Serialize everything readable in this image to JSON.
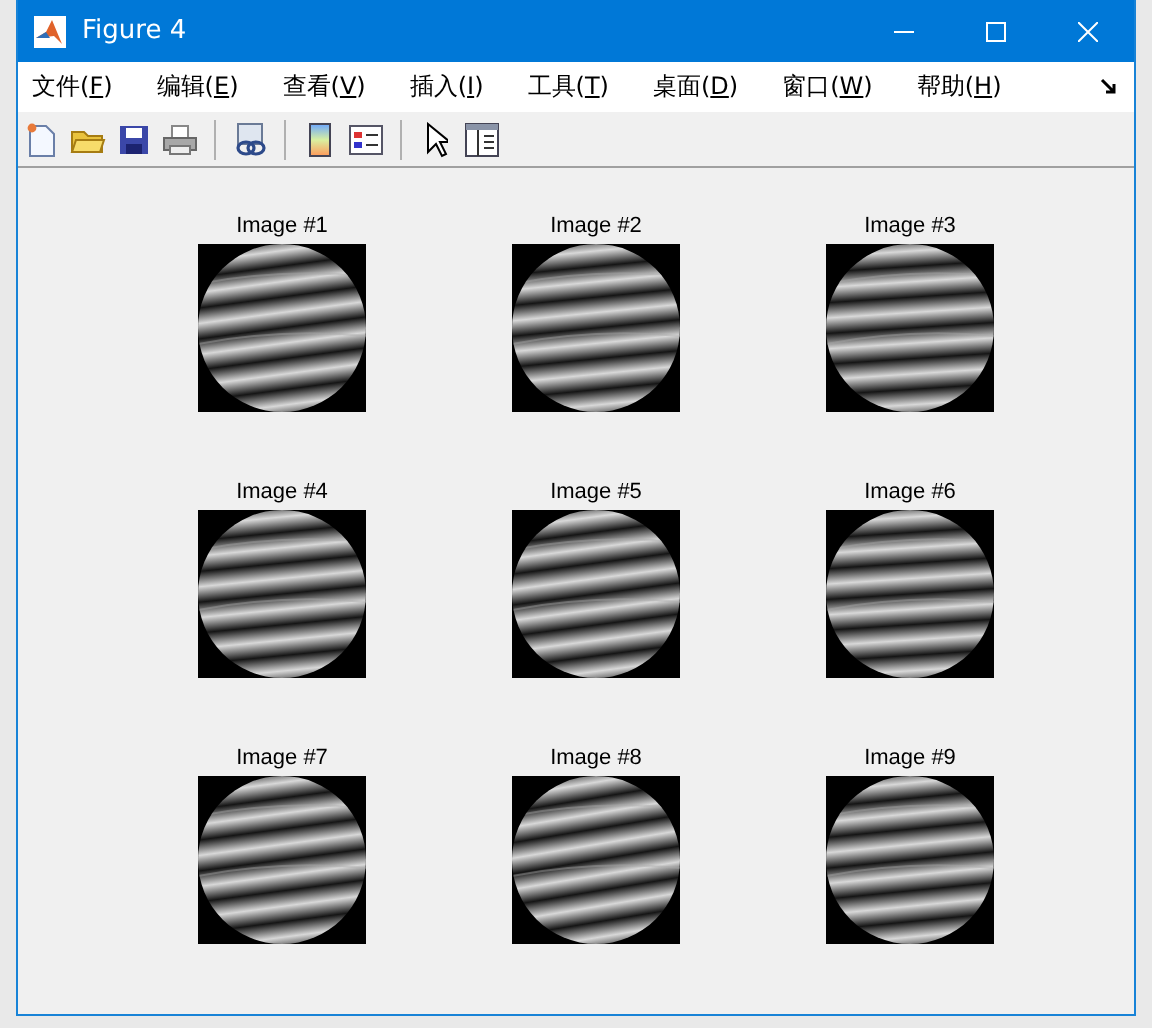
{
  "window": {
    "title": "Figure 4"
  },
  "menu": [
    {
      "label": "文件(F)"
    },
    {
      "label": "编辑(E)"
    },
    {
      "label": "查看(V)"
    },
    {
      "label": "插入(I)"
    },
    {
      "label": "工具(T)"
    },
    {
      "label": "桌面(D)"
    },
    {
      "label": "窗口(W)"
    },
    {
      "label": "帮助(H)"
    }
  ],
  "toolbar": [
    {
      "kind": "new"
    },
    {
      "kind": "open"
    },
    {
      "kind": "save"
    },
    {
      "kind": "print"
    },
    {
      "kind": "sep"
    },
    {
      "kind": "link"
    },
    {
      "kind": "sep"
    },
    {
      "kind": "colorbar"
    },
    {
      "kind": "legend"
    },
    {
      "kind": "sep"
    },
    {
      "kind": "pointer"
    },
    {
      "kind": "inspector"
    }
  ],
  "plots": [
    {
      "title": "Image #1"
    },
    {
      "title": "Image #2"
    },
    {
      "title": "Image #3"
    },
    {
      "title": "Image #4"
    },
    {
      "title": "Image #5"
    },
    {
      "title": "Image #6"
    },
    {
      "title": "Image #7"
    },
    {
      "title": "Image #8"
    },
    {
      "title": "Image #9"
    }
  ]
}
